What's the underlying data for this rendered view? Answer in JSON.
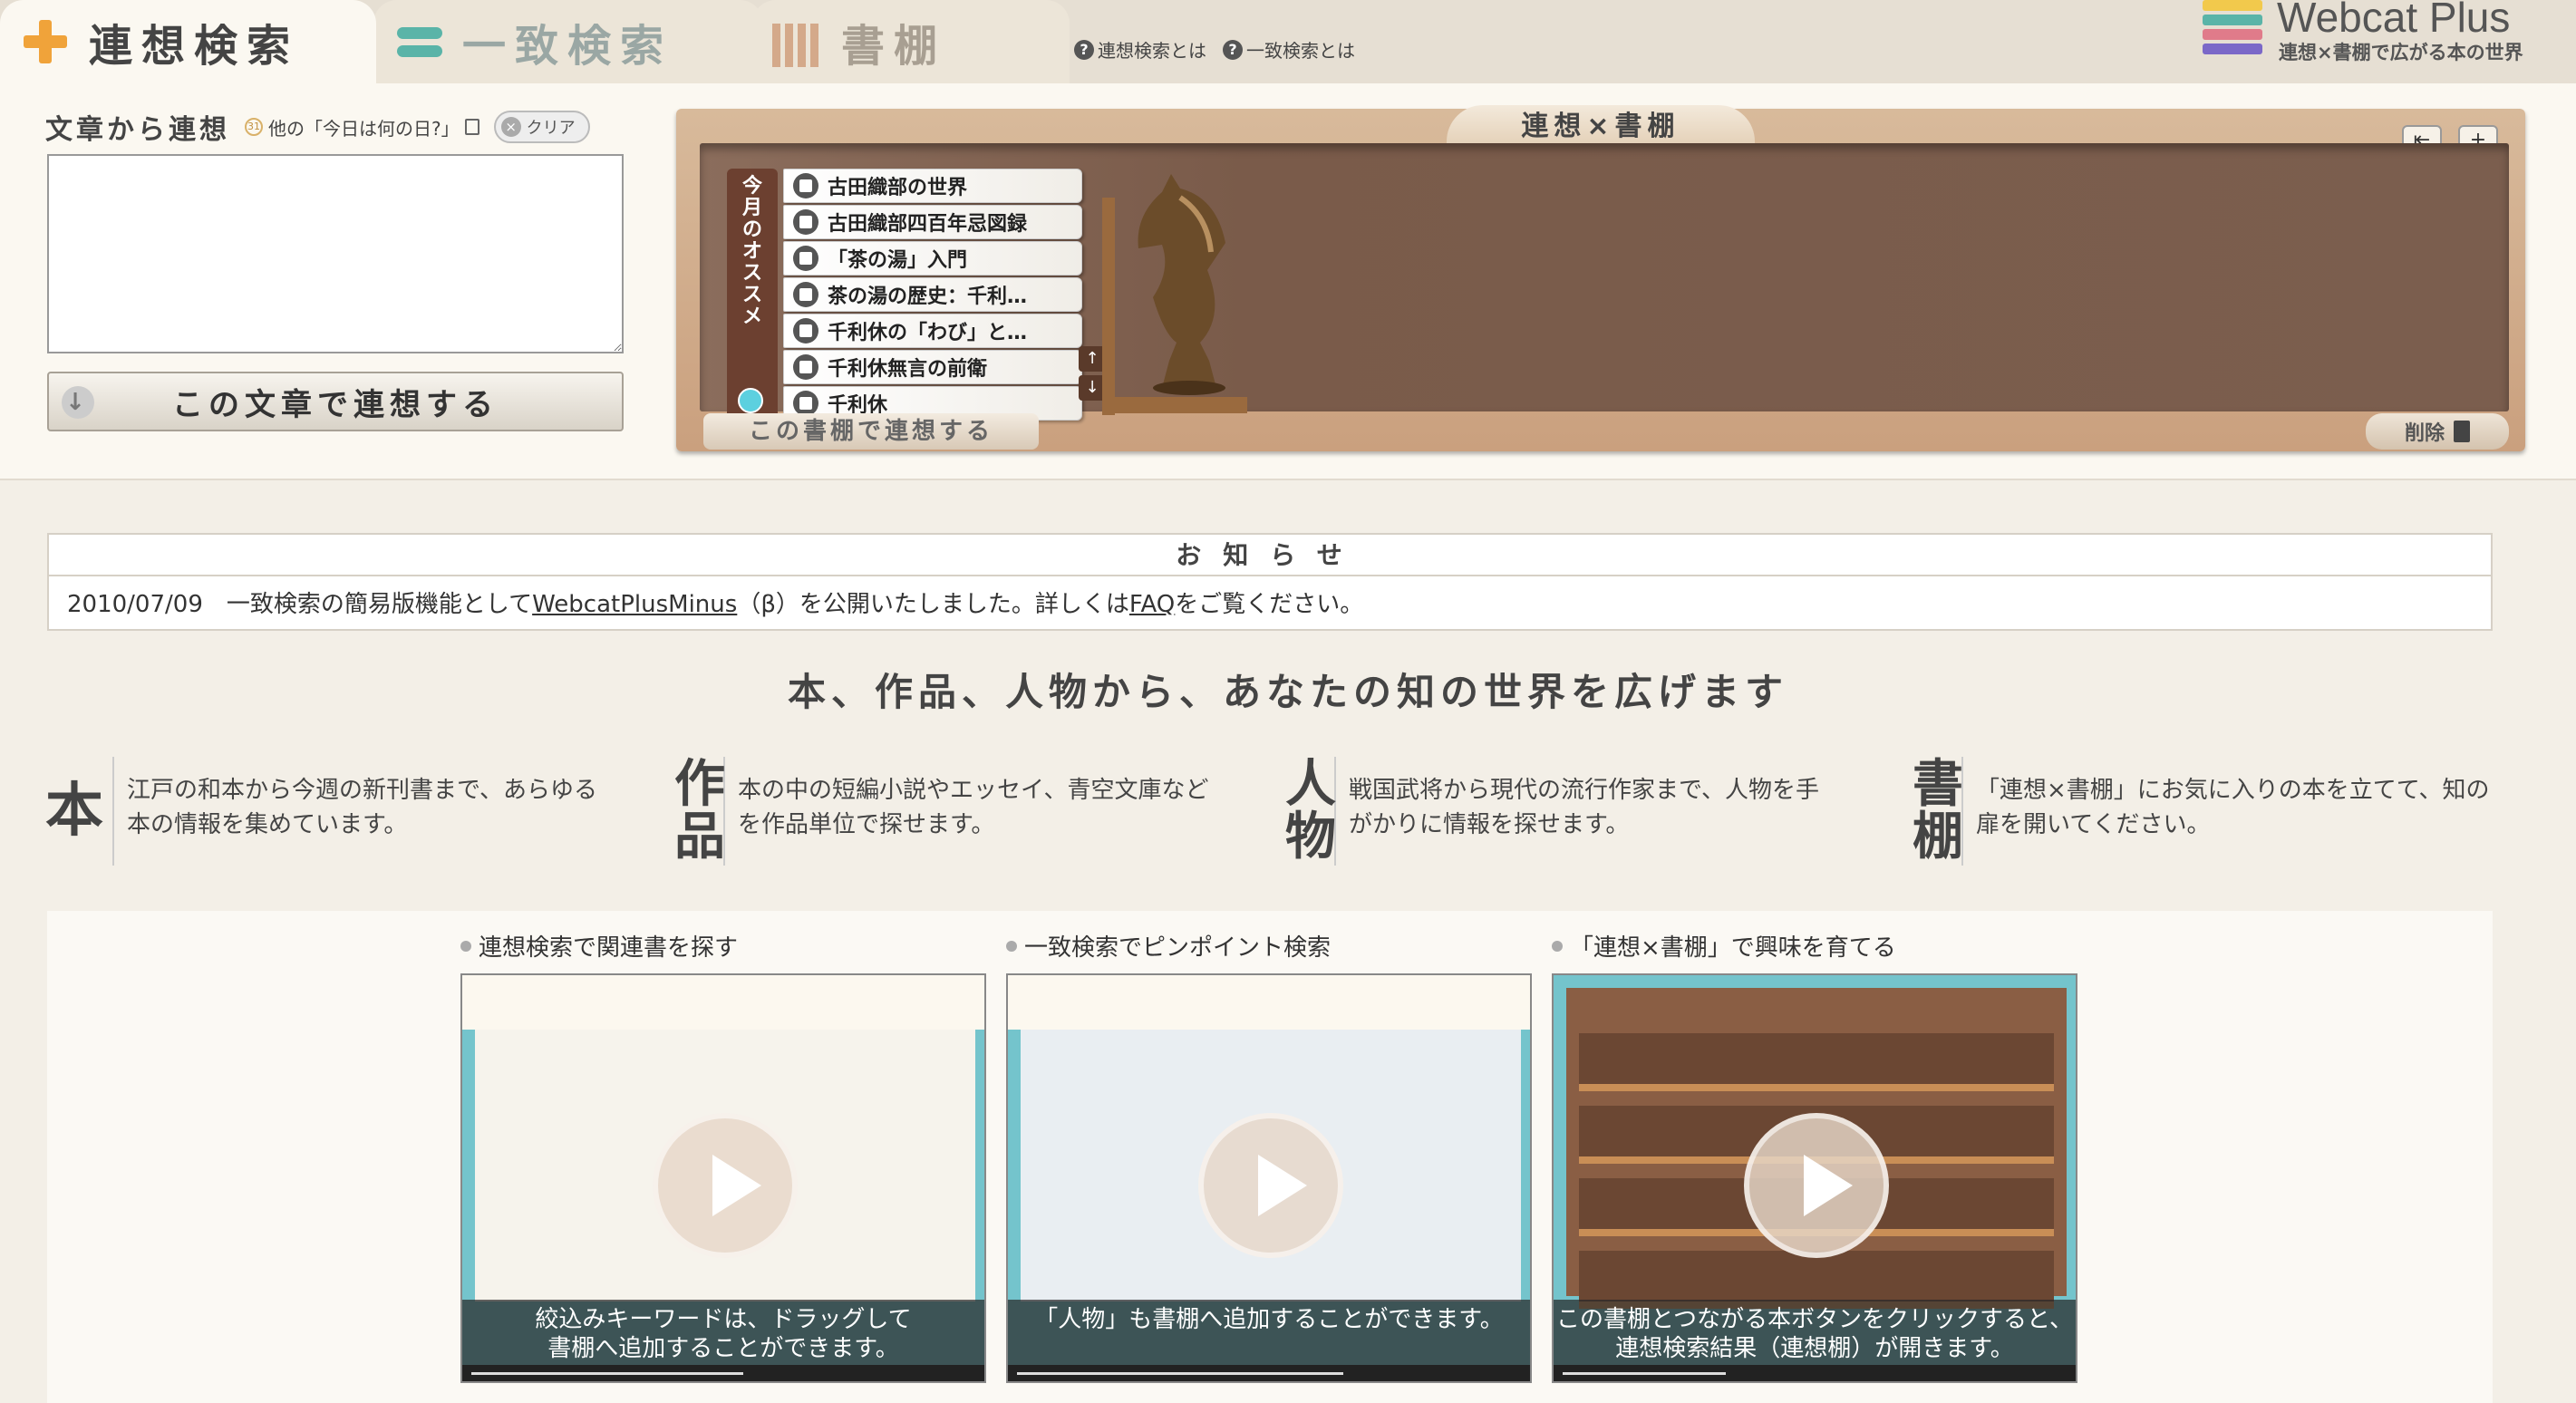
{
  "tabs": [
    {
      "label": "連想検索",
      "icon": "plus-icon",
      "active": true
    },
    {
      "label": "一致検索",
      "icon": "equals-icon",
      "active": false
    },
    {
      "label": "書棚",
      "icon": "bookshelf-icon",
      "active": false
    }
  ],
  "help_links": [
    "連想検索とは",
    "一致検索とは"
  ],
  "logo": {
    "title": "Webcat Plus",
    "subtitle": "連想×書棚で広がる本の世界",
    "bar_colors": [
      "#f2c94c",
      "#5ab4a8",
      "#e07b8a",
      "#7b68c8"
    ]
  },
  "assoc": {
    "title": "文章から連想",
    "other_link": "他の「今日は何の日?」",
    "clear_label": "クリア",
    "text_value": "",
    "button_label": "この文章で連想する"
  },
  "shelf": {
    "title": "連想×書棚",
    "recommend_label": [
      "今",
      "月",
      "の",
      "オ",
      "ス",
      "ス",
      "メ"
    ],
    "books": [
      "古田織部の世界",
      "古田織部四百年忌図録",
      "「茶の湯」入門",
      "茶の湯の歴史：千利…",
      "千利休の「わび」と…",
      "千利休無言の前衛",
      "千利休"
    ],
    "assoc_button": "この書棚で連想する",
    "delete_label": "削除"
  },
  "notice": {
    "heading": "お知らせ",
    "date": "2010/07/09",
    "text_before": "一致検索の簡易版機能として",
    "link1": "WebcatPlusMinus",
    "text_middle": "（β）を公開いたしました。詳しくは",
    "link2": "FAQ",
    "text_after": "をご覧ください。"
  },
  "tagline": "本、作品、人物から、あなたの知の世界を広げます",
  "features": [
    {
      "big": "本",
      "text": [
        "江戸の和本から今週の新刊書まで、あらゆる",
        "本の情報を集めています。"
      ]
    },
    {
      "big": "作品",
      "text": [
        "本の中の短編小説やエッセイ、青空文庫など",
        "を作品単位で探せます。"
      ]
    },
    {
      "big": "人物",
      "text": [
        "戦国武将から現代の流行作家まで、人物を手",
        "がかりに情報を探せます。"
      ]
    },
    {
      "big": "書棚",
      "text": [
        "「連想×書棚」にお気に入りの本を立てて、知の",
        "扉を開いてください。"
      ]
    }
  ],
  "videos": [
    {
      "title": "連想検索で関連書を探す",
      "caption": [
        "絞込みキーワードは、ドラッグして",
        "書棚へ追加することができます。"
      ]
    },
    {
      "title": "一致検索でピンポイント検索",
      "caption": [
        "「人物」も書棚へ追加することができます。",
        ""
      ]
    },
    {
      "title": "「連想×書棚」で興味を育てる",
      "caption": [
        "この書棚とつながる本ボタンをクリックすると、",
        "連想検索結果（連想棚）が開きます。"
      ]
    }
  ]
}
